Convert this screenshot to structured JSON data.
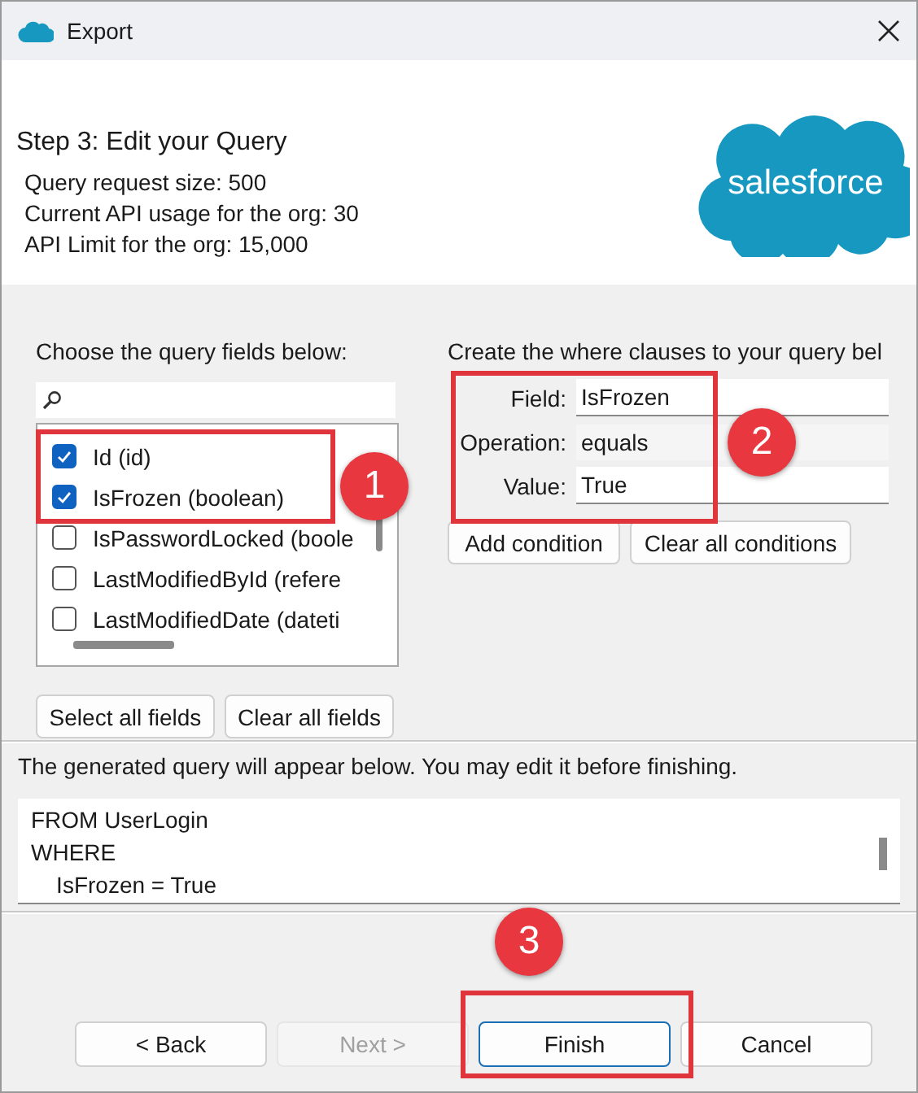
{
  "window": {
    "title": "Export"
  },
  "header": {
    "step_title": "Step 3: Edit your Query",
    "info_lines": [
      "Query request size: 500",
      "Current API usage for the org: 30",
      "API Limit for the org: 15,000"
    ],
    "logo_text": "salesforce"
  },
  "fields": {
    "label": "Choose the query fields below:",
    "items": [
      {
        "label": "Id (id)",
        "checked": true
      },
      {
        "label": "IsFrozen (boolean)",
        "checked": true
      },
      {
        "label": "IsPasswordLocked (boole",
        "checked": false
      },
      {
        "label": "LastModifiedById (refere",
        "checked": false
      },
      {
        "label": "LastModifiedDate (dateti",
        "checked": false
      }
    ],
    "buttons": [
      "Select all fields",
      "Clear all fields"
    ]
  },
  "conditions": {
    "label": "Create the where clauses to your query bel",
    "rows": [
      {
        "kind": "input",
        "label": "Field:",
        "value": "IsFrozen"
      },
      {
        "kind": "text",
        "label": "Operation:",
        "value": "equals"
      },
      {
        "kind": "input",
        "label": "Value:",
        "value": "True"
      }
    ],
    "buttons": [
      "Add condition",
      "Clear all conditions"
    ]
  },
  "query": {
    "label": "The generated query will appear below.  You may edit it before finishing.",
    "lines": [
      "FROM UserLogin",
      "WHERE",
      "    IsFrozen = True"
    ]
  },
  "buttons": [
    {
      "label": "< Back",
      "disabled": false,
      "selected": false
    },
    {
      "label": "Next >",
      "disabled": true,
      "selected": false
    },
    {
      "label": "Finish",
      "disabled": false,
      "selected": true
    },
    {
      "label": "Cancel",
      "disabled": false,
      "selected": false
    }
  ],
  "callouts": [
    "1",
    "2",
    "3"
  ]
}
